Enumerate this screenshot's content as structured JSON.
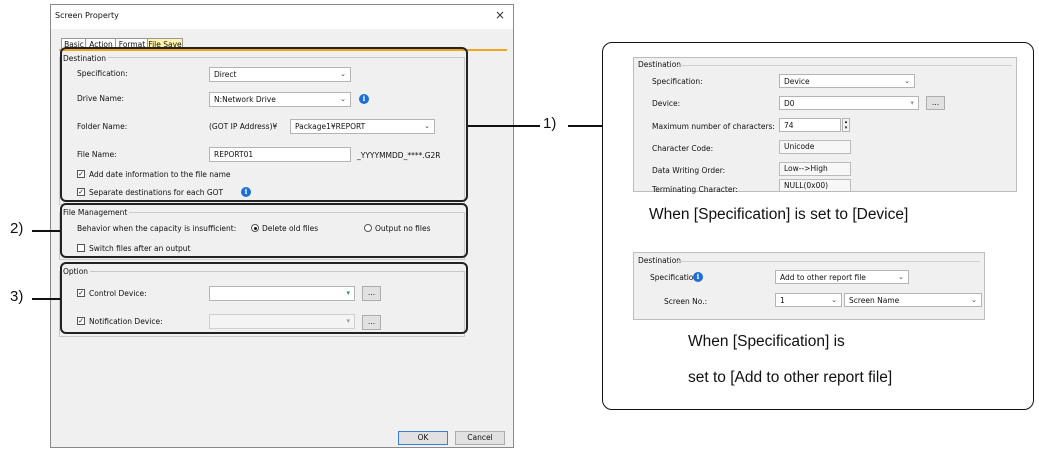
{
  "dialog": {
    "title": "Screen Property",
    "close_glyph": "×",
    "tabs": [
      {
        "label": "Basic"
      },
      {
        "label": "Action"
      },
      {
        "label": "Format"
      },
      {
        "label": "File Save"
      }
    ],
    "active_tab": "File Save",
    "accent_color": "#f0a51e",
    "destination": {
      "heading": "Destination",
      "specification_label": "Specification:",
      "specification_value": "Direct",
      "drive_label": "Drive Name:",
      "drive_value": "N:Network Drive",
      "folder_label": "Folder Name:",
      "folder_prefix": "(GOT IP Address)¥",
      "folder_value": "Package1¥REPORT",
      "file_label": "File Name:",
      "file_value": "REPORT01",
      "file_suffix": "_YYYYMMDD_****.G2R",
      "add_date_label": "Add date information to the file name",
      "add_date_checked": true,
      "separate_label": "Separate destinations for each GOT",
      "separate_checked": true
    },
    "file_management": {
      "heading": "File Management",
      "behavior_label": "Behavior when the capacity is insufficient:",
      "option_delete": "Delete old files",
      "option_output": "Output no files",
      "selected": "Delete old files",
      "switch_label": "Switch files after an output",
      "switch_checked": false
    },
    "option": {
      "heading": "Option",
      "control_label": "Control Device:",
      "control_checked": true,
      "notification_label": "Notification Device:",
      "notification_checked": true,
      "browse_label": "..."
    },
    "buttons": {
      "ok": "OK",
      "cancel": "Cancel"
    }
  },
  "annotations": {
    "label_1": "1)",
    "label_2": "2)",
    "label_3": "3)"
  },
  "callout": {
    "device_panel": {
      "heading": "Destination",
      "specification_label": "Specification:",
      "specification_value": "Device",
      "device_label": "Device:",
      "device_value": "D0",
      "maxchars_label": "Maximum number of characters:",
      "maxchars_value": "74",
      "charcode_label": "Character Code:",
      "charcode_value": "Unicode",
      "order_label": "Data Writing Order:",
      "order_value": "Low-->High",
      "terminating_label": "Terminating Character:",
      "terminating_value": "NULL(0x00)",
      "browse_label": "..."
    },
    "device_caption": "When [Specification] is set to [Device]",
    "report_panel": {
      "heading": "Destination",
      "specification_label": "Specification:",
      "specification_value": "Add to other report file",
      "screen_label": "Screen No.:",
      "screen_value": "1",
      "screen_name_value": "Screen Name"
    },
    "report_caption_line1": "When [Specification] is",
    "report_caption_line2": "set to [Add to other report file]"
  },
  "icons": {
    "info": "info-icon",
    "dropdown": "chevron-down-icon",
    "close": "close-icon",
    "spin": "spin-buttons-icon"
  }
}
